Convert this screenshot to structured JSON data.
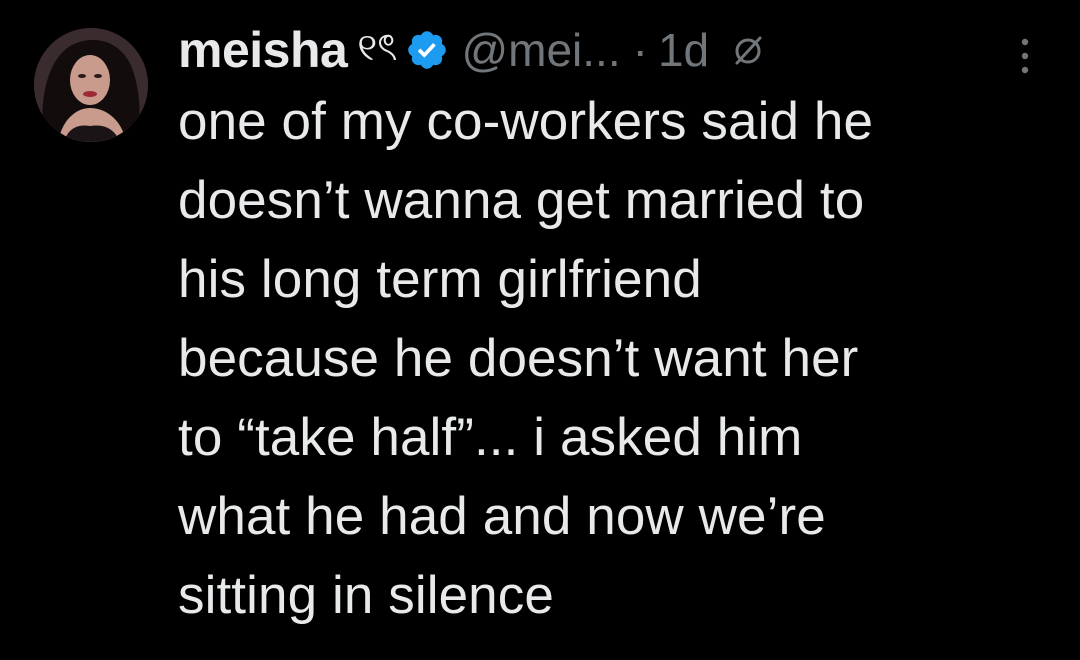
{
  "tweet": {
    "author": {
      "display_name": "meisha",
      "name_emoji": "୧ৎ",
      "verified_icon": "verified-badge-icon",
      "handle": "@mei...",
      "avatar_icon": "profile-photo"
    },
    "separator": "·",
    "timestamp": "1d",
    "restricted_icon": "restricted-replies-icon",
    "more_icon": "more-vertical-icon",
    "text": "one of my co-workers said he\ndoesn’t wanna get married to\nhis long term girlfriend\nbecause he doesn’t want her\nto “take half”... i asked him\nwhat he had and now we’re\nsitting in silence"
  },
  "colors": {
    "background": "#000000",
    "text_primary": "#e7e9ea",
    "text_secondary": "#71767b",
    "verified_blue": "#1d9bf0"
  }
}
